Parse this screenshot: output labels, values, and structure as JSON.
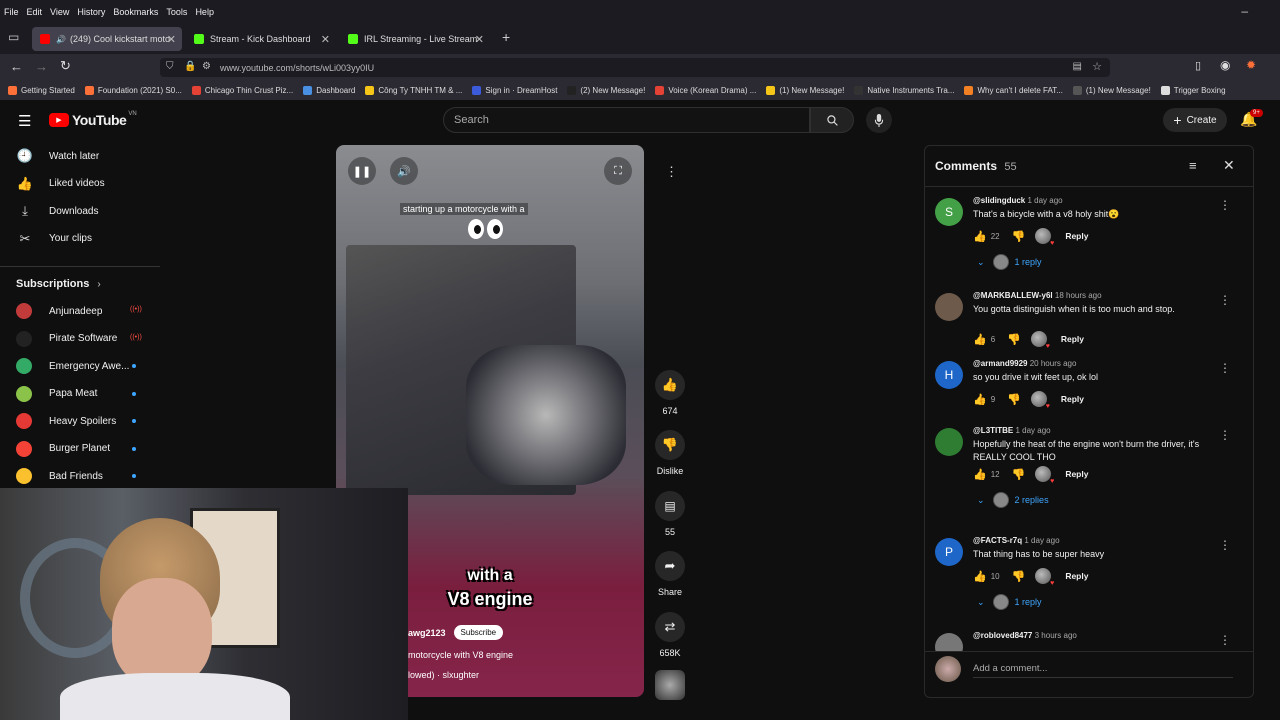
{
  "menubar": [
    "File",
    "Edit",
    "View",
    "History",
    "Bookmarks",
    "Tools",
    "Help"
  ],
  "tabs": [
    {
      "title": "(249) Cool kickstart motorc",
      "color": "#ff0000"
    },
    {
      "title": "Stream - Kick Dashboard",
      "color": "#53fc18"
    },
    {
      "title": "IRL Streaming - Live Streams or",
      "color": "#53fc18"
    }
  ],
  "url": "www.youtube.com/shorts/wLi003yy0IU",
  "bookmarks": [
    {
      "label": "Getting Started",
      "color": "#ff7139"
    },
    {
      "label": "Foundation (2021) S0...",
      "color": "#ff7139"
    },
    {
      "label": "Chicago Thin Crust Piz...",
      "color": "#e34234"
    },
    {
      "label": "Dashboard",
      "color": "#4a90e2"
    },
    {
      "label": "Công Ty TNHH TM & ...",
      "color": "#f5c518"
    },
    {
      "label": "Sign in · DreamHost",
      "color": "#3b5bdb"
    },
    {
      "label": "(2) New Message!",
      "color": "#222"
    },
    {
      "label": "Voice (Korean Drama) ...",
      "color": "#e34234"
    },
    {
      "label": "(1) New Message!",
      "color": "#f5c518"
    },
    {
      "label": "Native Instruments Tra...",
      "color": "#333"
    },
    {
      "label": "Why can't I delete FAT...",
      "color": "#f48024"
    },
    {
      "label": "(1) New Message!",
      "color": "#555"
    },
    {
      "label": "Trigger Boxing",
      "color": "#ddd"
    }
  ],
  "youtube": {
    "logo": "YouTube",
    "region": "VN",
    "search_placeholder": "Search",
    "create_label": "Create",
    "notif_count": "9+"
  },
  "sidebar": {
    "items": [
      {
        "label": "Watch later",
        "icon": "clock-icon"
      },
      {
        "label": "Liked videos",
        "icon": "thumb-up-icon"
      },
      {
        "label": "Downloads",
        "icon": "download-icon"
      },
      {
        "label": "Your clips",
        "icon": "scissors-icon"
      }
    ],
    "subscriptions_heading": "Subscriptions",
    "subscriptions": [
      {
        "label": "Anjunadeep",
        "color": "#c23b3b",
        "status": "live"
      },
      {
        "label": "Pirate Software",
        "color": "#222",
        "status": "live"
      },
      {
        "label": "Emergency Awe...",
        "color": "#3a6",
        "status": "new"
      },
      {
        "label": "Papa Meat",
        "color": "#8bc34a",
        "status": "new"
      },
      {
        "label": "Heavy Spoilers",
        "color": "#e53935",
        "status": "new"
      },
      {
        "label": "Burger Planet",
        "color": "#f44336",
        "status": "new"
      },
      {
        "label": "Bad Friends",
        "color": "#fbc02d",
        "status": "new"
      }
    ]
  },
  "video": {
    "caption_top": "starting up a motorcycle with a",
    "caption_big_1": "with a",
    "caption_big_2": "V8 engine",
    "channel": "awg2123",
    "subscribe": "Subscribe",
    "title": "motorcycle with V8 engine",
    "audio": "lowed) · slxughter"
  },
  "actions": {
    "likes": "674",
    "dislike": "Dislike",
    "comments": "55",
    "share": "Share",
    "remix": "658K"
  },
  "comments_panel": {
    "title": "Comments",
    "count": "55",
    "add_placeholder": "Add a comment...",
    "items": [
      {
        "user": "@slidingduck",
        "time": "1 day ago",
        "text": "That's a bicycle with a v8 holy shit😮",
        "likes": "22",
        "avatar_letter": "S",
        "avatar_color": "#43a047",
        "replies": "1 reply"
      },
      {
        "user": "@MARKBALLEW-y6l",
        "time": "18 hours ago",
        "text": "You gotta distinguish when  it is too much  and stop.",
        "likes": "6",
        "avatar_letter": "",
        "avatar_color": "#6d5a4a",
        "replies": ""
      },
      {
        "user": "@armand9929",
        "time": "20 hours ago",
        "text": "so you drive it wit feet up, ok lol",
        "likes": "9",
        "avatar_letter": "H",
        "avatar_color": "#1e66c8",
        "replies": ""
      },
      {
        "user": "@L3TITBE",
        "time": "1 day ago",
        "text": "Hopefully the heat of the engine won't burn the driver, it's REALLY COOL THO",
        "likes": "12",
        "avatar_letter": "",
        "avatar_color": "#2e7d32",
        "replies": "2 replies"
      },
      {
        "user": "@FACTS-r7q",
        "time": "1 day ago",
        "text": "That thing has to be super heavy",
        "likes": "10",
        "avatar_letter": "P",
        "avatar_color": "#1e66c8",
        "replies": "1 reply"
      },
      {
        "user": "@robloved8477",
        "time": "3 hours ago",
        "text": "",
        "likes": "",
        "avatar_letter": "",
        "avatar_color": "#777",
        "replies": ""
      }
    ],
    "reply_label": "Reply"
  }
}
